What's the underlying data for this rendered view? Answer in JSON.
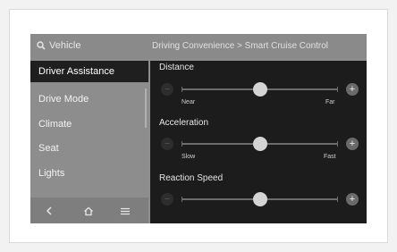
{
  "topbar": {
    "search_label": "Vehicle",
    "breadcrumb": "Driving Convenience > Smart Cruise Control"
  },
  "sidebar": {
    "items": [
      {
        "label": "Driver Assistance",
        "active": true
      },
      {
        "label": "Drive Mode",
        "active": false
      },
      {
        "label": "Climate",
        "active": false
      },
      {
        "label": "Seat",
        "active": false
      },
      {
        "label": "Lights",
        "active": false
      }
    ]
  },
  "bottombar": {
    "icons": [
      "back-icon",
      "home-icon",
      "menu-icon"
    ]
  },
  "settings": [
    {
      "title": "Distance",
      "low_label": "Near",
      "high_label": "Far",
      "value": 0.5
    },
    {
      "title": "Acceleration",
      "low_label": "Slow",
      "high_label": "Fast",
      "value": 0.5
    },
    {
      "title": "Reaction Speed",
      "low_label": "",
      "high_label": "",
      "value": 0.5
    }
  ],
  "colors": {
    "panel_bg": "#1c1c1c",
    "sidebar_bg": "#8d8d8d",
    "active_item_bg": "#1f1f1f",
    "knob": "#d4d4d4"
  }
}
